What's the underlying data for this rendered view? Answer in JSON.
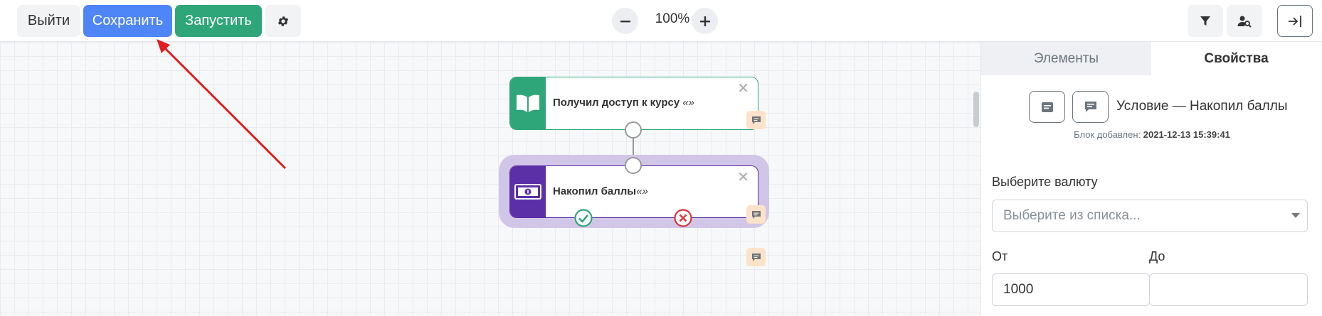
{
  "toolbar": {
    "exit_label": "Выйти",
    "save_label": "Сохранить",
    "run_label": "Запустить",
    "zoom_level": "100%",
    "exit_icon": "sign-out-icon"
  },
  "canvas": {
    "nodes": [
      {
        "title": "Получил доступ к курсу",
        "quote": "«»",
        "color": "#2fa67a",
        "icon": "book-icon"
      },
      {
        "title": "Накопил баллы",
        "quote": "«»",
        "color": "#5b2fa6",
        "icon": "money-icon"
      }
    ],
    "annotation_color": "#e21d1d",
    "selection_color": "#d2c6e8"
  },
  "panel": {
    "tabs": [
      "Элементы",
      "Свойства"
    ],
    "active_tab": "Свойства",
    "block_title": "Условие — Накопил баллы",
    "added_label": "Блок добавлен:",
    "added_value": "2021-12-13 15:39:41",
    "currency_label": "Выберите валюту",
    "currency_placeholder": "Выберите из списка...",
    "from_label": "От",
    "to_label": "До",
    "from_value": "1000",
    "to_value": ""
  }
}
